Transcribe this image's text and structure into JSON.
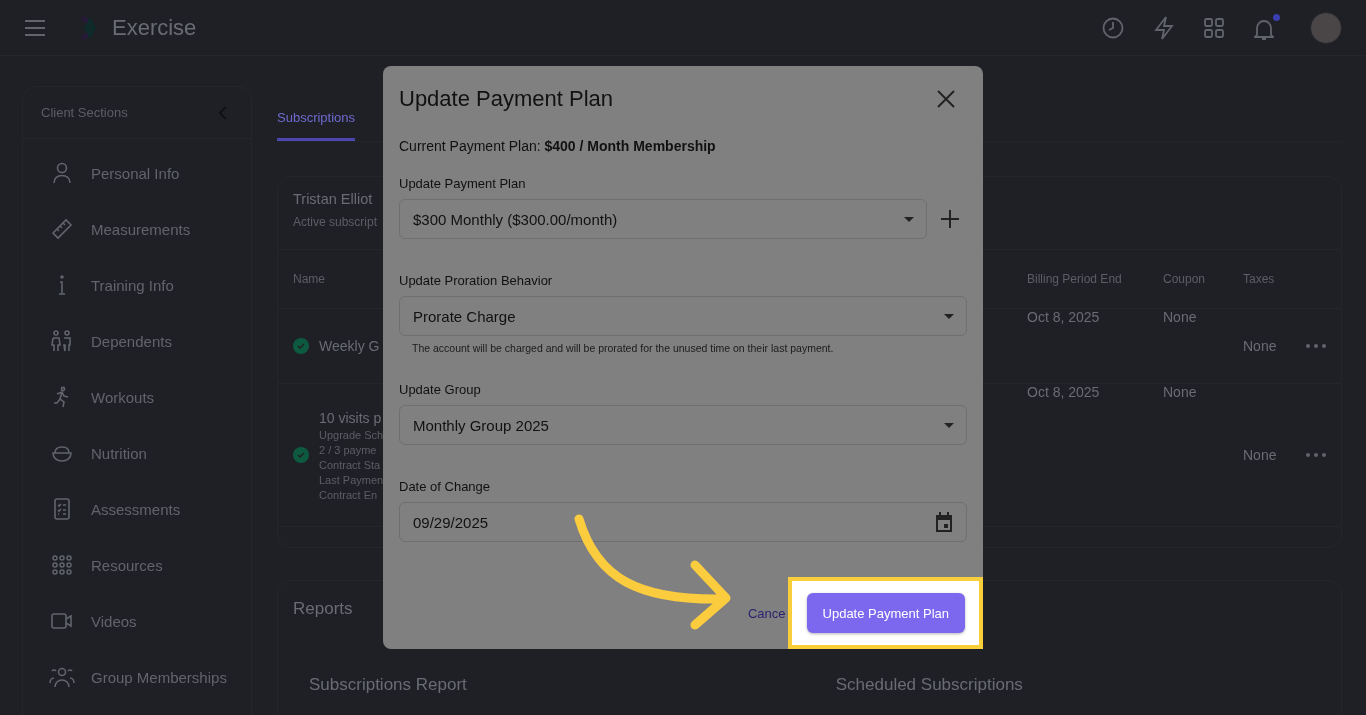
{
  "app": {
    "name": "Exercise",
    "has_notification": true
  },
  "sidebar": {
    "title": "Client Sections",
    "items": [
      {
        "label": "Personal Info",
        "kind": "person"
      },
      {
        "label": "Measurements",
        "kind": "ruler"
      },
      {
        "label": "Training Info",
        "kind": "info"
      },
      {
        "label": "Dependents",
        "kind": "family"
      },
      {
        "label": "Workouts",
        "kind": "runner"
      },
      {
        "label": "Nutrition",
        "kind": "bowl"
      },
      {
        "label": "Assessments",
        "kind": "checklist"
      },
      {
        "label": "Resources",
        "kind": "dots"
      },
      {
        "label": "Videos",
        "kind": "video"
      },
      {
        "label": "Group Memberships",
        "kind": "group"
      }
    ]
  },
  "tabs": [
    {
      "label": "Subscriptions",
      "selected": true
    }
  ],
  "subscriptions": {
    "title": "Tristan Elliot",
    "subtitle": "Active subscript",
    "columns": [
      "Name",
      "Billing Period End",
      "Coupon",
      "Taxes"
    ],
    "rows": [
      {
        "name": "Weekly G",
        "details": [],
        "end": "Oct 8, 2025",
        "coupon": "None",
        "taxes": "None",
        "active": true
      },
      {
        "name": "10 visits p",
        "details": [
          "Upgrade Sch",
          "2 / 3 payme",
          "Contract Sta",
          "Last Paymen",
          "Contract En"
        ],
        "end": "Oct 8, 2025",
        "coupon": "None",
        "taxes": "None",
        "active": true
      }
    ]
  },
  "reports": {
    "title": "Reports",
    "cards": [
      "Subscriptions Report",
      "Scheduled Subscriptions"
    ]
  },
  "dialog": {
    "title": "Update Payment Plan",
    "current": "Current Payment Plan: **$400 / Month Membership**",
    "fields": [
      {
        "label": "Update Payment Plan",
        "value": "$300 Monthly ($300.00/month)",
        "kind": "select",
        "addable": true
      },
      {
        "label": "Update Proration Behavior",
        "value": "Prorate Charge",
        "kind": "select",
        "help": "The account will be charged and will be prorated for the unused time on their last payment."
      },
      {
        "label": "Update Group",
        "value": "Monthly Group 2025",
        "kind": "select"
      },
      {
        "label": "Date of Change",
        "value": "09/29/2025",
        "kind": "date"
      }
    ],
    "cancel": "Cance",
    "submit": "Update Payment Plan",
    "highlighted": true
  }
}
